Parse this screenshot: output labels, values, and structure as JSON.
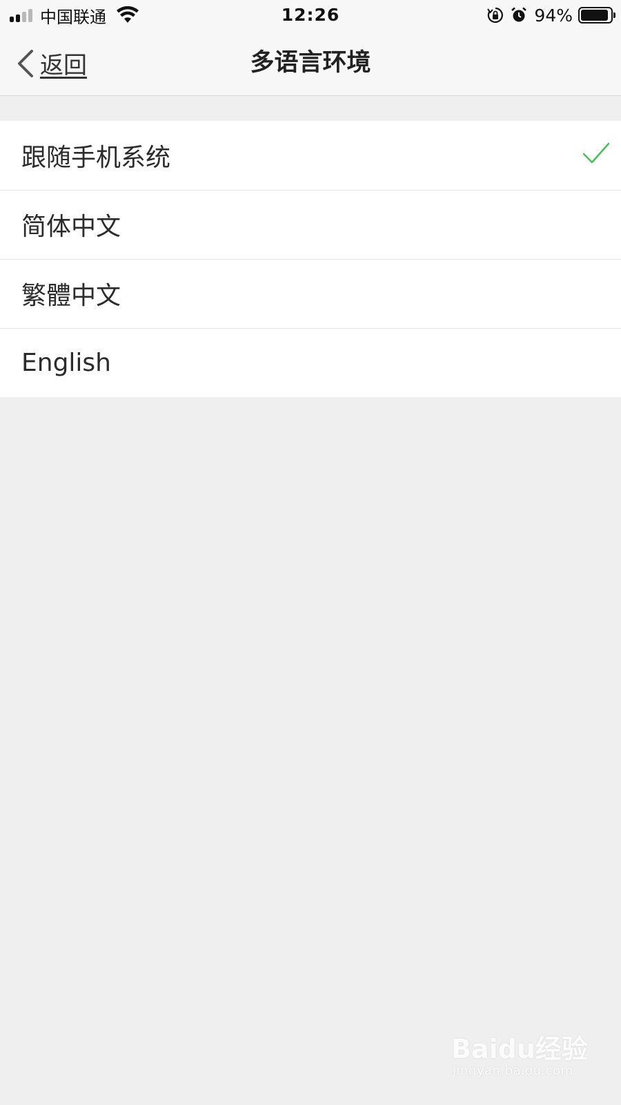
{
  "status_bar": {
    "carrier": "中国联通",
    "time": "12:26",
    "battery_percent": "94%",
    "battery_level": 0.94,
    "icons": [
      "signal-icon",
      "wifi-icon",
      "rotation-lock-icon",
      "alarm-icon",
      "battery-icon"
    ]
  },
  "nav": {
    "back_label": "返回",
    "title": "多语言环境"
  },
  "languages": {
    "items": [
      {
        "label": "跟随手机系统",
        "selected": true
      },
      {
        "label": "简体中文",
        "selected": false
      },
      {
        "label": "繁體中文",
        "selected": false
      },
      {
        "label": "English",
        "selected": false
      }
    ]
  },
  "watermark": {
    "brand": "Baidu经验",
    "url": "jingyan.baidu.com"
  },
  "colors": {
    "accent_check": "#4cbf5a",
    "background": "#efefef",
    "bar_background": "#f7f7f7"
  }
}
